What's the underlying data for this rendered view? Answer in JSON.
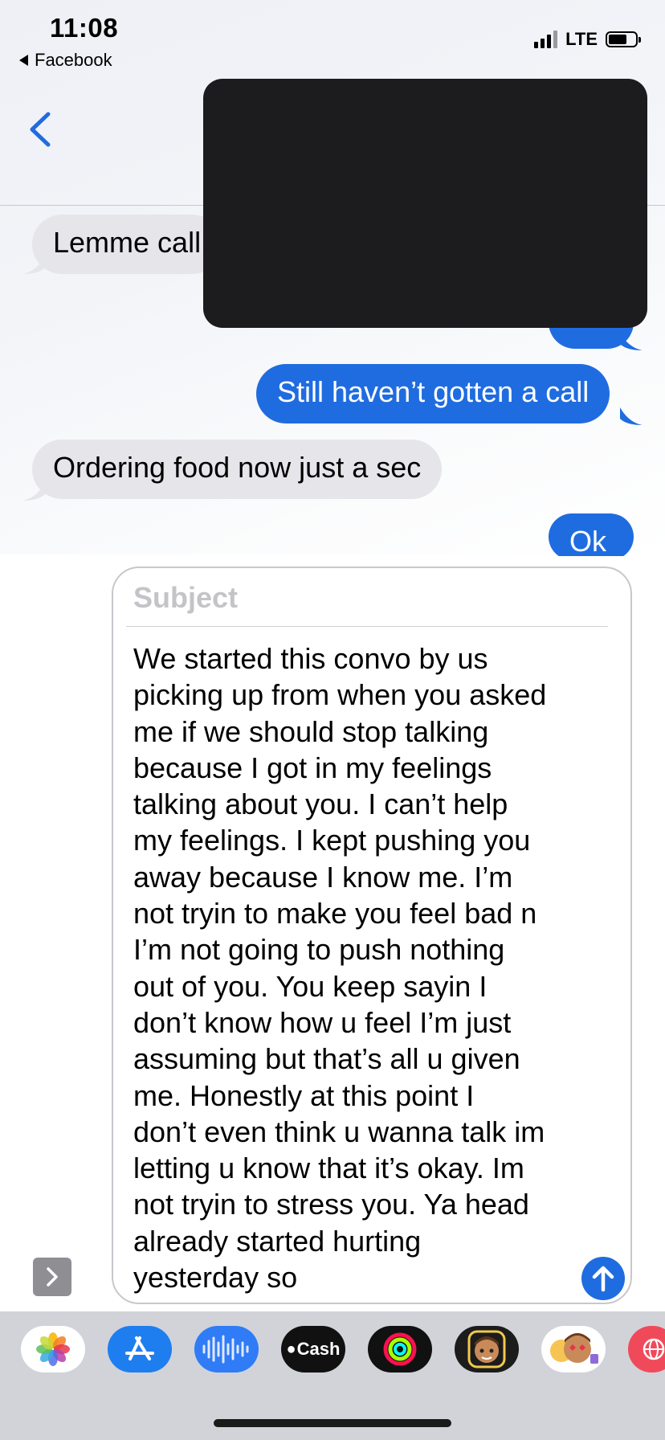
{
  "status_bar": {
    "time": "11:08",
    "back_app": "Facebook",
    "network": "LTE"
  },
  "nav": {
    "back_icon": "chevron-left-icon"
  },
  "messages": [
    {
      "direction": "incoming",
      "text": "Lemme call"
    },
    {
      "direction": "outgoing",
      "text": "Ok"
    },
    {
      "direction": "outgoing",
      "text": "Still haven’t gotten a call"
    },
    {
      "direction": "incoming",
      "text": "Ordering food now just a sec"
    },
    {
      "direction": "outgoing",
      "text": "Ok"
    }
  ],
  "compose": {
    "subject_placeholder": "Subject",
    "body": "We started this convo by us\npicking up from when you asked\nme if we should stop talking\nbecause I got in my feelings\ntalking about you. I can’t help\nmy feelings. I kept pushing you\naway because I know me. I’m\nnot tryin to make you feel bad n\nI’m not going to push nothing\nout of you. You keep sayin I\ndon’t know how u feel I’m just\nassuming but that’s all u given\nme. Honestly at this point I\ndon’t even think u wanna talk im\nletting u know that it’s okay. Im\nnot tryin to stress you. Ya head\nalready started hurting\nyesterday so",
    "send_icon": "arrow-up-icon",
    "expand_icon": "chevron-right-icon"
  },
  "app_drawer": {
    "apps": [
      {
        "name": "photos-icon"
      },
      {
        "name": "app-store-icon"
      },
      {
        "name": "audio-message-icon"
      },
      {
        "name": "apple-cash-icon",
        "label": "Cash"
      },
      {
        "name": "fitness-rings-icon"
      },
      {
        "name": "memoji-icon"
      },
      {
        "name": "memoji-stickers-icon"
      },
      {
        "name": "web-search-icon"
      }
    ]
  },
  "colors": {
    "accent_blue": "#1f6ce0",
    "incoming_bubble": "#e6e6ea",
    "overlay": "#1c1c1e",
    "drawer": "#d1d3d9"
  }
}
